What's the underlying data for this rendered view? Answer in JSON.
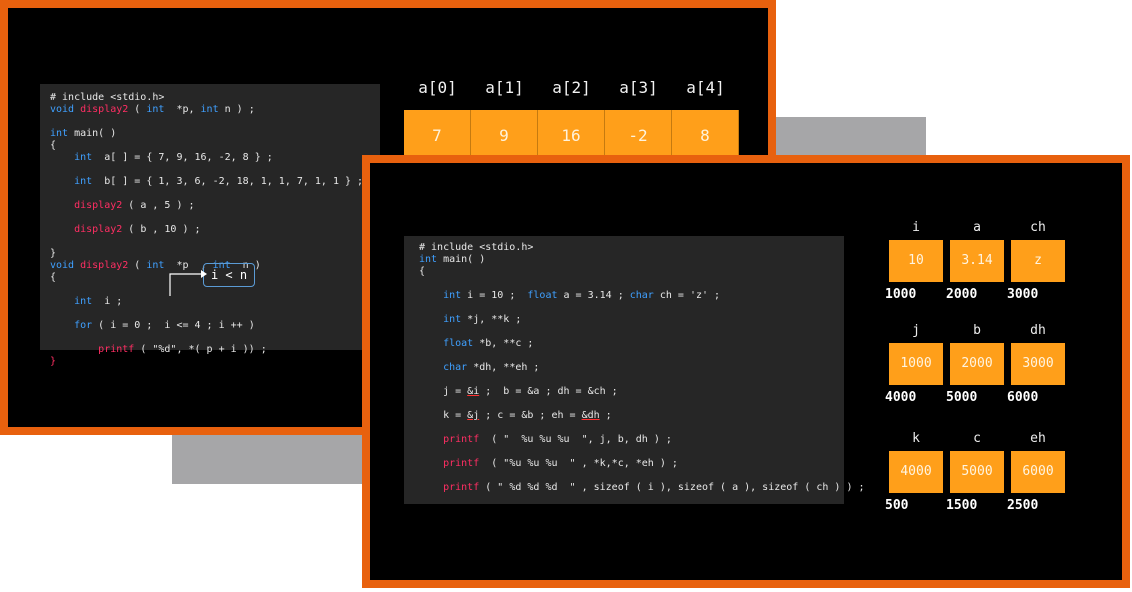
{
  "slide1": {
    "code": [
      [
        {
          "t": "# include <stdio.h>"
        }
      ],
      [
        {
          "t": "void ",
          "c": "kw"
        },
        {
          "t": "display2",
          "c": "fn"
        },
        {
          "t": " ( "
        },
        {
          "t": "int",
          "c": "kw"
        },
        {
          "t": "  *p, "
        },
        {
          "t": "int",
          "c": "kw"
        },
        {
          "t": " n ) ;"
        }
      ],
      [
        {
          "t": ""
        }
      ],
      [
        {
          "t": "int",
          "c": "kw"
        },
        {
          "t": " main( )"
        }
      ],
      [
        {
          "t": "{"
        }
      ],
      [
        {
          "t": "    "
        },
        {
          "t": "int",
          "c": "kw"
        },
        {
          "t": "  a[ ] = { 7, 9, 16, -2, 8 } ;"
        }
      ],
      [
        {
          "t": ""
        }
      ],
      [
        {
          "t": "    "
        },
        {
          "t": "int",
          "c": "kw"
        },
        {
          "t": "  b[ ] = { 1, 3, 6, -2, 18, 1, 1, 7, 1, 1 } ;"
        }
      ],
      [
        {
          "t": ""
        }
      ],
      [
        {
          "t": "    "
        },
        {
          "t": "display2",
          "c": "fn"
        },
        {
          "t": " ( a , 5 ) ;"
        }
      ],
      [
        {
          "t": ""
        }
      ],
      [
        {
          "t": "    "
        },
        {
          "t": "display2",
          "c": "fn"
        },
        {
          "t": " ( b , 10 ) ;"
        }
      ],
      [
        {
          "t": ""
        }
      ],
      [
        {
          "t": "}"
        }
      ],
      [
        {
          "t": "void ",
          "c": "kw"
        },
        {
          "t": "display2",
          "c": "fn"
        },
        {
          "t": " ( "
        },
        {
          "t": "int",
          "c": "kw"
        },
        {
          "t": "  *p  , "
        },
        {
          "t": "int",
          "c": "kw"
        },
        {
          "t": "  n )"
        }
      ],
      [
        {
          "t": "{"
        }
      ],
      [
        {
          "t": ""
        }
      ],
      [
        {
          "t": "    "
        },
        {
          "t": "int",
          "c": "kw"
        },
        {
          "t": "  i ;"
        }
      ],
      [
        {
          "t": ""
        }
      ],
      [
        {
          "t": "    "
        },
        {
          "t": "for",
          "c": "kw"
        },
        {
          "t": " ( i = 0 ;  i <= 4 ; i ++ )"
        }
      ],
      [
        {
          "t": ""
        }
      ],
      [
        {
          "t": "        "
        },
        {
          "t": "printf",
          "c": "fn"
        },
        {
          "t": " ( \"%d\", *( p + i )) ;"
        }
      ],
      [
        {
          "t": "}",
          "c": "fn"
        }
      ]
    ],
    "callout": "i < n",
    "array_headers": [
      "a[0]",
      "a[1]",
      "a[2]",
      "a[3]",
      "a[4]"
    ],
    "array_values": [
      "7",
      "9",
      "16",
      "-2",
      "8"
    ]
  },
  "slide2": {
    "code": [
      [
        {
          "t": "# include <stdio.h>"
        }
      ],
      [
        {
          "t": "int",
          "c": "kw"
        },
        {
          "t": " main( )"
        }
      ],
      [
        {
          "t": "{"
        }
      ],
      [
        {
          "t": ""
        }
      ],
      [
        {
          "t": "    "
        },
        {
          "t": "int",
          "c": "kw"
        },
        {
          "t": " i = 10 ;  "
        },
        {
          "t": "float",
          "c": "kw"
        },
        {
          "t": " a = 3.14 ; "
        },
        {
          "t": "char",
          "c": "kw"
        },
        {
          "t": " ch = 'z' ;"
        }
      ],
      [
        {
          "t": ""
        }
      ],
      [
        {
          "t": "    "
        },
        {
          "t": "int",
          "c": "kw"
        },
        {
          "t": " *j, **k ;"
        }
      ],
      [
        {
          "t": ""
        }
      ],
      [
        {
          "t": "    "
        },
        {
          "t": "float",
          "c": "kw"
        },
        {
          "t": " *b, **c ;"
        }
      ],
      [
        {
          "t": ""
        }
      ],
      [
        {
          "t": "    "
        },
        {
          "t": "char",
          "c": "kw"
        },
        {
          "t": " *dh, **eh ;"
        }
      ],
      [
        {
          "t": ""
        }
      ],
      [
        {
          "t": "    j = "
        },
        {
          "t": "&i",
          "c": "ul"
        },
        {
          "t": " ;  b = &a ; dh = &ch ;"
        }
      ],
      [
        {
          "t": ""
        }
      ],
      [
        {
          "t": "    k = "
        },
        {
          "t": "&j",
          "c": "ul"
        },
        {
          "t": " ; c = &b ; eh = "
        },
        {
          "t": "&dh",
          "c": "ul"
        },
        {
          "t": " ;"
        }
      ],
      [
        {
          "t": ""
        }
      ],
      [
        {
          "t": "    "
        },
        {
          "t": "printf",
          "c": "fn"
        },
        {
          "t": "  ( \"  %u %u %u  \", j, b, dh ) ;"
        }
      ],
      [
        {
          "t": ""
        }
      ],
      [
        {
          "t": "    "
        },
        {
          "t": "printf",
          "c": "fn"
        },
        {
          "t": "  ( \"%u %u %u  \" , *k,*c, *eh ) ;"
        }
      ],
      [
        {
          "t": ""
        }
      ],
      [
        {
          "t": "    "
        },
        {
          "t": "printf",
          "c": "fn"
        },
        {
          "t": " ( \" %d %d %d  \" , sizeof ( i ), sizeof ( a ), sizeof ( ch ) ) ;"
        }
      ]
    ],
    "memory": [
      {
        "names": [
          "i",
          "a",
          "ch"
        ],
        "values": [
          "10",
          "3.14",
          "z"
        ],
        "addresses": [
          "1000",
          "2000",
          "3000"
        ]
      },
      {
        "names": [
          "j",
          "b",
          "dh"
        ],
        "values": [
          "1000",
          "2000",
          "3000"
        ],
        "addresses": [
          "4000",
          "5000",
          "6000"
        ]
      },
      {
        "names": [
          "k",
          "c",
          "eh"
        ],
        "values": [
          "4000",
          "5000",
          "6000"
        ],
        "addresses": [
          "500",
          "1500",
          "2500"
        ]
      }
    ]
  },
  "colors": {
    "frame": "#e8610e",
    "cell": "#ff9f1a",
    "keyword": "#3fa0ff",
    "function": "#ff2e63"
  }
}
